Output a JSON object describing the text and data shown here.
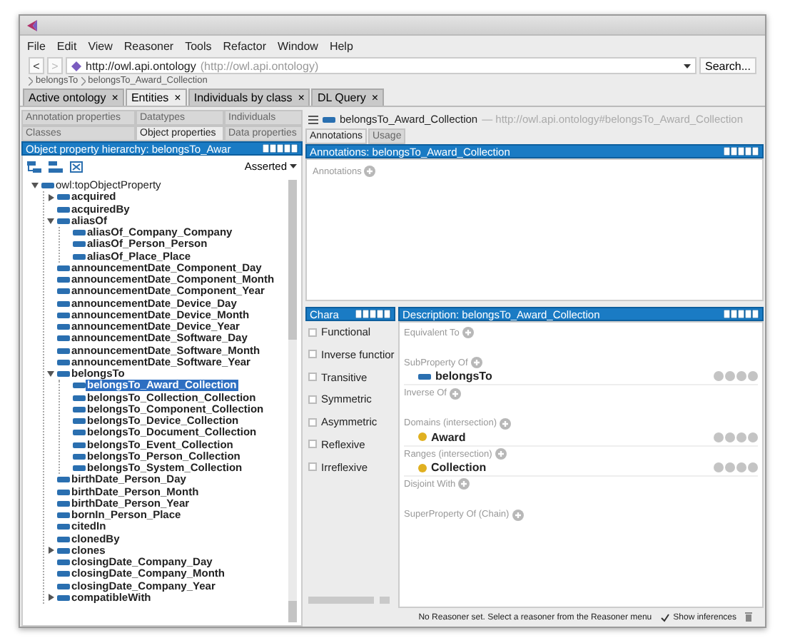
{
  "menu": [
    "File",
    "Edit",
    "View",
    "Reasoner",
    "Tools",
    "Refactor",
    "Window",
    "Help"
  ],
  "address": {
    "back": "<",
    "forward": ">",
    "url": "http://owl.api.ontology",
    "hint": "(http://owl.api.ontology)",
    "search": "Search..."
  },
  "breadcrumb": [
    "belongsTo",
    "belongsTo_Award_Collection"
  ],
  "main_tabs": [
    {
      "label": "Active ontology",
      "close": "×",
      "selected": false
    },
    {
      "label": "Entities",
      "close": "×",
      "selected": true
    },
    {
      "label": "Individuals by class",
      "close": "×",
      "selected": false
    },
    {
      "label": "DL Query",
      "close": "×",
      "selected": false
    }
  ],
  "entity_tabs": [
    [
      {
        "label": "Annotation properties",
        "selected": false
      },
      {
        "label": "Datatypes",
        "selected": false
      },
      {
        "label": "Individuals",
        "selected": false
      }
    ],
    [
      {
        "label": "Classes",
        "selected": false
      },
      {
        "label": "Object properties",
        "selected": true
      },
      {
        "label": "Data properties",
        "selected": false
      }
    ]
  ],
  "hierarchy": {
    "title": "Object property hierarchy: belongsTo_Awar",
    "mode": "Asserted",
    "tree": [
      {
        "label": "owl:topObjectProperty",
        "selected": false,
        "expanded": true,
        "children": [
          {
            "label": "acquired",
            "selected": false,
            "expanded": false
          },
          {
            "label": "acquiredBy",
            "selected": false
          },
          {
            "label": "aliasOf",
            "selected": false,
            "expanded": true,
            "children": [
              {
                "label": "aliasOf_Company_Company",
                "selected": false
              },
              {
                "label": "aliasOf_Person_Person",
                "selected": false
              },
              {
                "label": "aliasOf_Place_Place",
                "selected": false
              }
            ]
          },
          {
            "label": "announcementDate_Component_Day",
            "selected": false
          },
          {
            "label": "announcementDate_Component_Month",
            "selected": false
          },
          {
            "label": "announcementDate_Component_Year",
            "selected": false
          },
          {
            "label": "announcementDate_Device_Day",
            "selected": false
          },
          {
            "label": "announcementDate_Device_Month",
            "selected": false
          },
          {
            "label": "announcementDate_Device_Year",
            "selected": false
          },
          {
            "label": "announcementDate_Software_Day",
            "selected": false
          },
          {
            "label": "announcementDate_Software_Month",
            "selected": false
          },
          {
            "label": "announcementDate_Software_Year",
            "selected": false
          },
          {
            "label": "belongsTo",
            "selected": false,
            "expanded": true,
            "children": [
              {
                "label": "belongsTo_Award_Collection",
                "selected": true
              },
              {
                "label": "belongsTo_Collection_Collection",
                "selected": false
              },
              {
                "label": "belongsTo_Component_Collection",
                "selected": false
              },
              {
                "label": "belongsTo_Device_Collection",
                "selected": false
              },
              {
                "label": "belongsTo_Document_Collection",
                "selected": false
              },
              {
                "label": "belongsTo_Event_Collection",
                "selected": false
              },
              {
                "label": "belongsTo_Person_Collection",
                "selected": false
              },
              {
                "label": "belongsTo_System_Collection",
                "selected": false
              }
            ]
          },
          {
            "label": "birthDate_Person_Day",
            "selected": false
          },
          {
            "label": "birthDate_Person_Month",
            "selected": false
          },
          {
            "label": "birthDate_Person_Year",
            "selected": false
          },
          {
            "label": "bornIn_Person_Place",
            "selected": false
          },
          {
            "label": "citedIn",
            "selected": false
          },
          {
            "label": "clonedBy",
            "selected": false
          },
          {
            "label": "clones",
            "selected": false,
            "expanded": false
          },
          {
            "label": "closingDate_Company_Day",
            "selected": false
          },
          {
            "label": "closingDate_Company_Month",
            "selected": false
          },
          {
            "label": "closingDate_Company_Year",
            "selected": false
          },
          {
            "label": "compatibleWith",
            "selected": false,
            "expanded": false
          }
        ]
      }
    ]
  },
  "entity": {
    "name": "belongsTo_Award_Collection",
    "iri": "— http://owl.api.ontology#belongsTo_Award_Collection"
  },
  "entity_tabs_right": [
    {
      "label": "Annotations",
      "selected": true
    },
    {
      "label": "Usage",
      "selected": false
    }
  ],
  "annotations": {
    "title": "Annotations: belongsTo_Award_Collection",
    "label": "Annotations"
  },
  "characteristics": {
    "title": "Chara",
    "items": [
      {
        "label": "Functional",
        "checked": false
      },
      {
        "label": "Inverse functior",
        "checked": false
      },
      {
        "label": "Transitive",
        "checked": false
      },
      {
        "label": "Symmetric",
        "checked": false
      },
      {
        "label": "Asymmetric",
        "checked": false
      },
      {
        "label": "Reflexive",
        "checked": false
      },
      {
        "label": "Irreflexive",
        "checked": false
      }
    ]
  },
  "description": {
    "title": "Description: belongsTo_Award_Collection",
    "sections": [
      {
        "label": "Equivalent To"
      },
      {
        "label": "SubProperty Of",
        "entries": [
          {
            "name": "belongsTo",
            "kind": "property"
          }
        ]
      },
      {
        "label": "Inverse Of"
      },
      {
        "label": "Domains (intersection)",
        "entries": [
          {
            "name": "Award",
            "kind": "class"
          }
        ]
      },
      {
        "label": "Ranges (intersection)",
        "entries": [
          {
            "name": "Collection",
            "kind": "class"
          }
        ]
      },
      {
        "label": "Disjoint With"
      },
      {
        "label": "SuperProperty Of (Chain)"
      }
    ]
  },
  "status_bar": {
    "message": "No Reasoner set. Select a reasoner from the Reasoner menu",
    "show_inferences": {
      "label": "Show inferences",
      "checked": true
    }
  }
}
